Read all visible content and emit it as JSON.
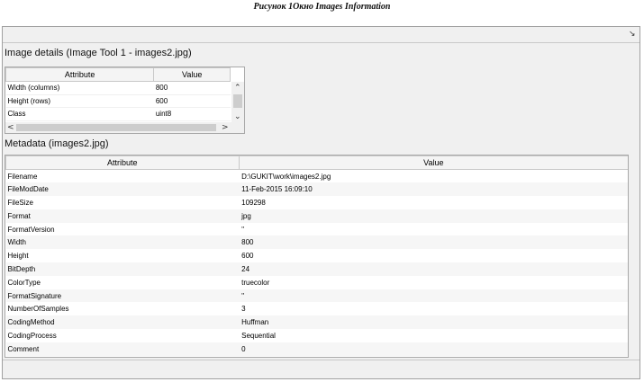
{
  "caption": "Рисунок 1Окно Images Information",
  "toolbar": {
    "corner_icon": "↘"
  },
  "image_details": {
    "title": "Image details  (Image Tool 1 - images2.jpg)",
    "columns": [
      "Attribute",
      "Value"
    ],
    "rows": [
      {
        "attribute": "Width (columns)",
        "value": "800"
      },
      {
        "attribute": "Height (rows)",
        "value": "600"
      },
      {
        "attribute": "Class",
        "value": "uint8"
      }
    ],
    "scroll": {
      "up": "⌃",
      "down": "⌄",
      "left": "<",
      "right": ">"
    }
  },
  "metadata": {
    "title": "Metadata (images2.jpg)",
    "columns": [
      "Attribute",
      "Value"
    ],
    "rows": [
      {
        "attribute": "Filename",
        "value": "D:\\GUKIT\\work\\images2.jpg"
      },
      {
        "attribute": "FileModDate",
        "value": "11-Feb-2015 16:09:10"
      },
      {
        "attribute": "FileSize",
        "value": "109298"
      },
      {
        "attribute": "Format",
        "value": "jpg"
      },
      {
        "attribute": "FormatVersion",
        "value": "''"
      },
      {
        "attribute": "Width",
        "value": "800"
      },
      {
        "attribute": "Height",
        "value": "600"
      },
      {
        "attribute": "BitDepth",
        "value": "24"
      },
      {
        "attribute": "ColorType",
        "value": "truecolor"
      },
      {
        "attribute": "FormatSignature",
        "value": "''"
      },
      {
        "attribute": "NumberOfSamples",
        "value": "3"
      },
      {
        "attribute": "CodingMethod",
        "value": "Huffman"
      },
      {
        "attribute": "CodingProcess",
        "value": "Sequential"
      },
      {
        "attribute": "Comment",
        "value": "0"
      }
    ]
  }
}
